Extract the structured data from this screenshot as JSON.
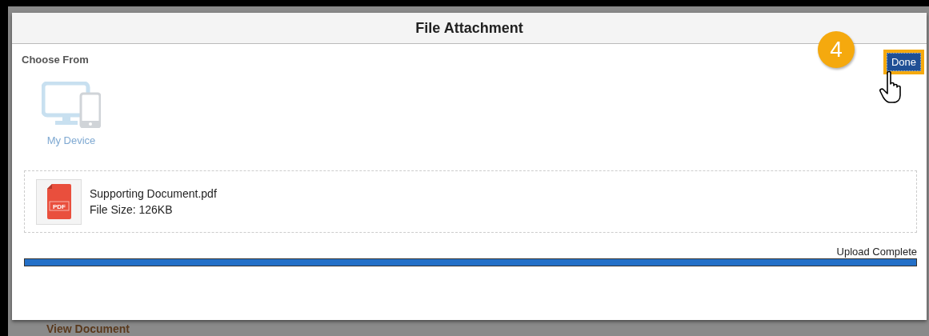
{
  "dialog": {
    "title": "File Attachment"
  },
  "choose_from": {
    "label": "Choose From",
    "sources": [
      {
        "label": "My Device",
        "disabled": true
      }
    ]
  },
  "files": [
    {
      "name": "Supporting Document.pdf",
      "size": "File Size: 126KB",
      "type_label": "PDF"
    }
  ],
  "upload": {
    "status": "Upload Complete",
    "level": 1
  },
  "done_button": {
    "label": "Done",
    "highlighted": true
  },
  "callout": {
    "step": "4"
  },
  "background": {
    "link": "View Document"
  }
}
